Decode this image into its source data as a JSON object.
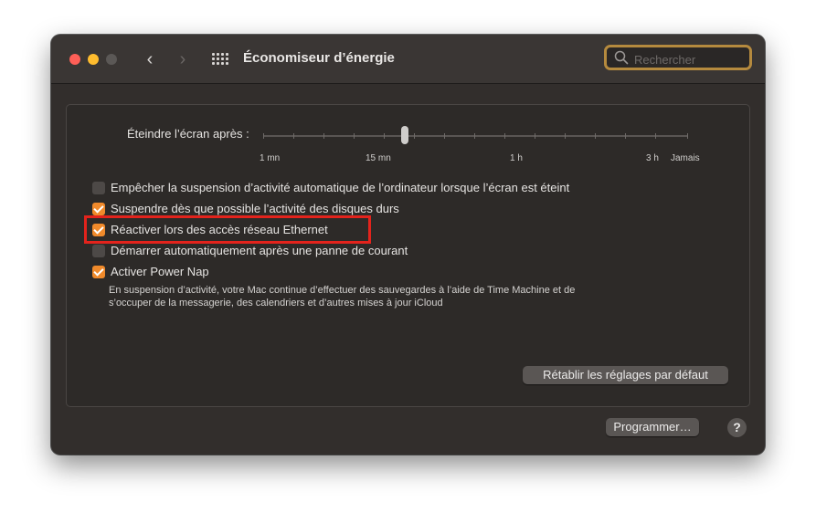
{
  "window": {
    "title": "Économiseur d’énergie",
    "search": {
      "placeholder": "Rechercher"
    }
  },
  "sleep_slider": {
    "label": "Éteindre l’écran après :",
    "tick_labels": [
      "1 mn",
      "15 mn",
      "1 h",
      "3 h",
      "Jamais"
    ]
  },
  "options": [
    {
      "label": "Empêcher la suspension d’activité automatique de l’ordinateur lorsque l’écran est éteint",
      "checked": false
    },
    {
      "label": "Suspendre dès que possible l’activité des disques durs",
      "checked": true
    },
    {
      "label": "Réactiver lors des accès réseau Ethernet",
      "checked": true,
      "highlighted": true
    },
    {
      "label": "Démarrer automatiquement après une panne de courant",
      "checked": false
    },
    {
      "label": "Activer Power Nap",
      "checked": true
    }
  ],
  "power_nap_description": "En suspension d’activité, votre Mac continue d’effectuer des sauvegardes à l’aide de Time Machine et de s’occuper de la messagerie, des calendriers et d’autres mises à jour iCloud",
  "buttons": {
    "restore_defaults": "Rétablir les réglages par défaut",
    "schedule": "Programmer…",
    "help": "?"
  },
  "colors": {
    "accent": "#f08a2b",
    "highlight_box": "#e3231c",
    "search_focus": "#b58a3e"
  }
}
